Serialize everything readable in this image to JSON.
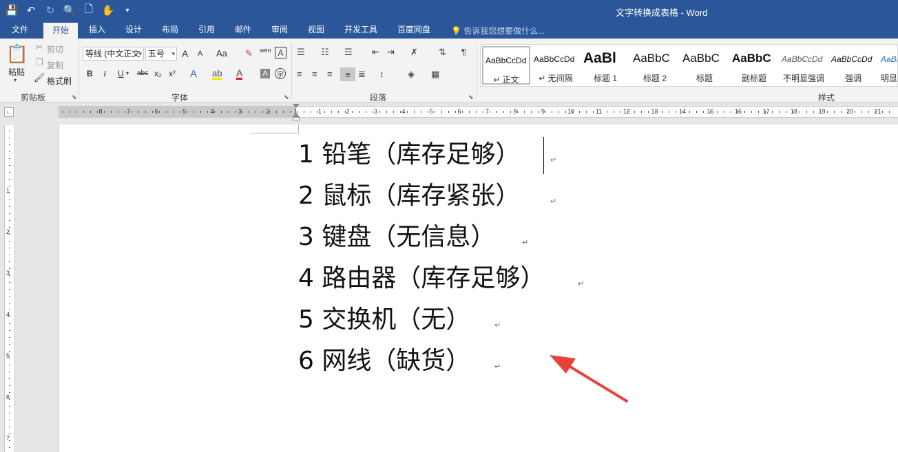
{
  "window": {
    "title": "文字转换成表格 - Word",
    "quick_access": [
      "save-icon",
      "undo-icon",
      "redo-icon",
      "print-preview-icon",
      "new-doc-icon",
      "touch-mode-icon",
      "customize-icon"
    ]
  },
  "tabs": [
    {
      "label": "文件",
      "active": false
    },
    {
      "label": "开始",
      "active": true
    },
    {
      "label": "插入",
      "active": false
    },
    {
      "label": "设计",
      "active": false
    },
    {
      "label": "布局",
      "active": false
    },
    {
      "label": "引用",
      "active": false
    },
    {
      "label": "邮件",
      "active": false
    },
    {
      "label": "审阅",
      "active": false
    },
    {
      "label": "视图",
      "active": false
    },
    {
      "label": "开发工具",
      "active": false
    },
    {
      "label": "百度网盘",
      "active": false
    }
  ],
  "tell_me": "告诉我您想要做什么...",
  "clipboard": {
    "paste": "粘贴",
    "cut": "剪切",
    "copy": "复制",
    "format_painter": "格式刷",
    "group": "剪贴板"
  },
  "font": {
    "name": "等线 (中文正文",
    "size": "五号",
    "group": "字体",
    "bold": "B",
    "italic": "I",
    "underline": "U",
    "strike": "abc",
    "subscript": "x₂",
    "superscript": "x²",
    "grow": "A",
    "shrink": "A",
    "case": "Aa",
    "wen": "wén",
    "color_letter": "A"
  },
  "paragraph": {
    "group": "段落"
  },
  "styles": {
    "group": "样式",
    "items": [
      {
        "preview": "AaBbCcDd",
        "name": "↵ 正文",
        "selected": true
      },
      {
        "preview": "AaBbCcDd",
        "name": "↵ 无间隔",
        "selected": false
      },
      {
        "preview": "AaBl",
        "name": "标题 1",
        "selected": false
      },
      {
        "preview": "AaBbC",
        "name": "标题 2",
        "selected": false
      },
      {
        "preview": "AaBbC",
        "name": "标题",
        "selected": false
      },
      {
        "preview": "AaBbC",
        "name": "副标题",
        "selected": false
      },
      {
        "preview": "AaBbCcDd",
        "name": "不明显强调",
        "selected": false
      },
      {
        "preview": "AaBbCcDd",
        "name": "强调",
        "selected": false
      },
      {
        "preview": "AaBb",
        "name": "明显",
        "selected": false
      }
    ]
  },
  "ruler": {
    "left_numbers": [
      "8",
      "7",
      "6",
      "5",
      "4",
      "3",
      "2",
      "1"
    ],
    "right_numbers": [
      "1",
      "2",
      "3",
      "4",
      "5",
      "6",
      "7",
      "8",
      "9",
      "10",
      "11",
      "12",
      "13",
      "14",
      "15",
      "16",
      "17",
      "18",
      "19",
      "20",
      "21"
    ],
    "vertical_numbers": [
      "1",
      "2",
      "3",
      "4",
      "5",
      "6",
      "7",
      "8"
    ]
  },
  "document": {
    "lines": [
      "1 铅笔（库存足够）",
      "2 鼠标（库存紧张）",
      "3 键盘（无信息）",
      "4 路由器（库存足够）",
      "5 交换机（无）",
      "6 网线（缺货）"
    ],
    "paragraph_mark": "↵"
  },
  "colors": {
    "title_bar": "#2b579a",
    "ribbon": "#f3f3f3",
    "annotation_arrow": "#e8403a"
  }
}
